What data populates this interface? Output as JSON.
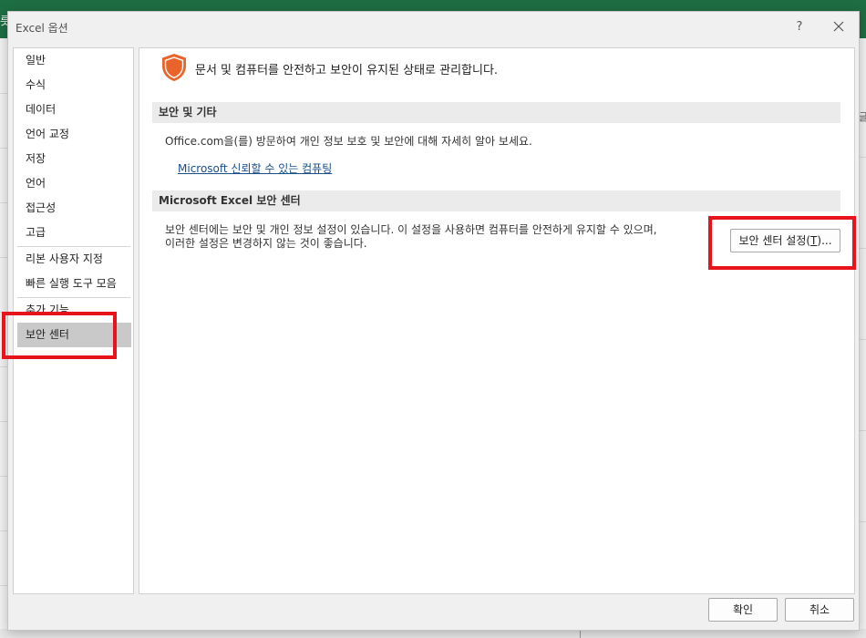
{
  "background": {
    "title_fragment": "",
    "left_edge_char": "릇",
    "right_edge_char": "글"
  },
  "dialog": {
    "title": "Excel 옵션",
    "help_label": "?",
    "ok_label": "확인",
    "cancel_label": "취소"
  },
  "nav": {
    "items": [
      {
        "label": "일반"
      },
      {
        "label": "수식"
      },
      {
        "label": "데이터"
      },
      {
        "label": "언어 교정"
      },
      {
        "label": "저장"
      },
      {
        "label": "언어"
      },
      {
        "label": "접근성"
      },
      {
        "label": "고급"
      },
      {
        "label": "리본 사용자 지정"
      },
      {
        "label": "빠른 실행 도구 모음"
      },
      {
        "label": "추가 기능"
      },
      {
        "label": "보안 센터"
      }
    ],
    "selected_label": "보안 센터"
  },
  "content": {
    "header": "문서 및 컴퓨터를 안전하고 보안이 유지된 상태로 관리합니다.",
    "section1_title": "보안 및 기타",
    "section1_text": "Office.com을(를) 방문하여 개인 정보 보호 및 보안에 대해 자세히 알아 보세요.",
    "section1_link": "Microsoft 신뢰할 수 있는 컴퓨팅",
    "section2_title": "Microsoft Excel 보안 센터",
    "section2_line1": "보안 센터에는 보안 및 개인 정보 설정이 있습니다. 이 설정을 사용하면 컴퓨터를 안전하게 유지할 수 있으며,",
    "section2_line2": "이러한 설정은 변경하지 않는 것이 좋습니다.",
    "trust_button": {
      "prefix": "보안 센터 설정(",
      "accel": "T",
      "suffix": ")..."
    }
  },
  "colors": {
    "annotation": "#e8141b",
    "ribbon": "#1e6e43",
    "shield": "#e8642a",
    "link": "#1a4f8a"
  }
}
